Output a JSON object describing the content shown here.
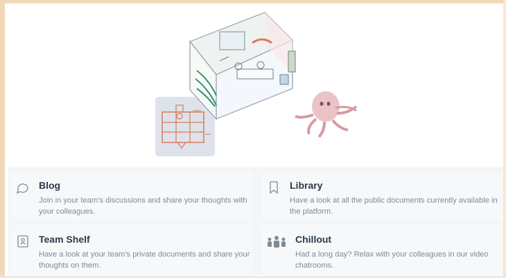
{
  "features": [
    {
      "title": "Blog",
      "desc": "Join in your team's discussions and share your thoughts with your colleagues.",
      "icon": "chat-bubble-icon"
    },
    {
      "title": "Library",
      "desc": "Have a look at all the public documents currently available in the platform.",
      "icon": "bookmark-icon"
    },
    {
      "title": "Team Shelf",
      "desc": "Have a look at your team's private documents and share your thoughts on them.",
      "icon": "contact-card-icon"
    },
    {
      "title": "Chillout",
      "desc": "Had a long day? Relax with your colleagues in our video chatrooms.",
      "icon": "people-group-icon"
    }
  ],
  "colors": {
    "frame": "#f0d9b8",
    "panel": "#f6f8fa",
    "title": "#2b3a4a",
    "desc": "#7f8a96",
    "sketch_orange": "#d77b55",
    "sketch_pink": "#e7b8bd"
  }
}
